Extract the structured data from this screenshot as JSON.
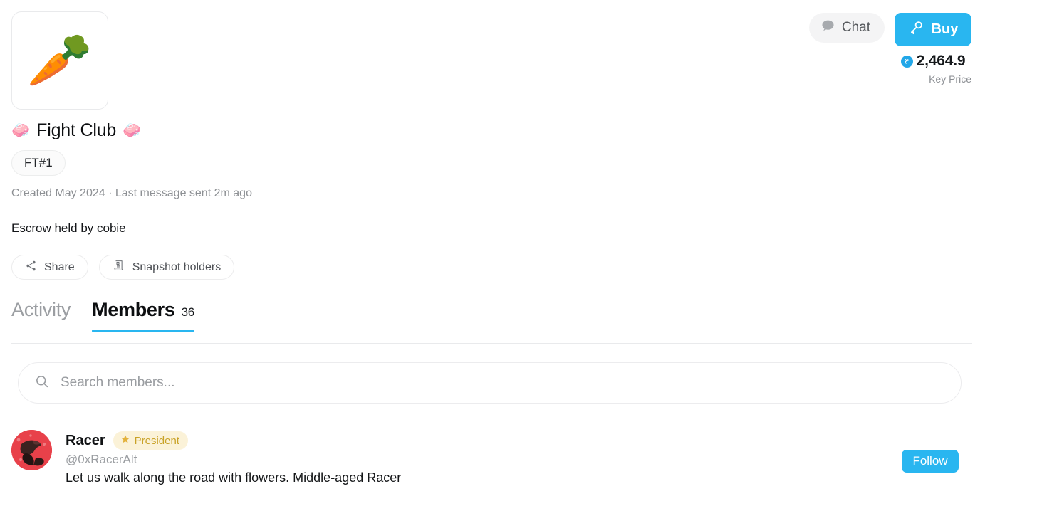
{
  "header": {
    "group_emoji": "🥕",
    "title_emoji_left": "🧼",
    "title_emoji_right": "🧼",
    "title": "Fight Club",
    "ticker_badge": "FT#1",
    "meta": "Created May 2024 · Last message sent 2m ago",
    "escrow": "Escrow held by cobie"
  },
  "actions": {
    "chat_label": "Chat",
    "chat_icon": "speech-bubble-icon",
    "buy_label": "Buy",
    "buy_icon": "key-icon",
    "price_value": "2,464.9",
    "price_coin_icon": "coin-icon",
    "price_label": "Key Price",
    "accent_color": "#29b6f0"
  },
  "chips": [
    {
      "label": "Share",
      "icon": "share-nodes-icon"
    },
    {
      "label": "Snapshot holders",
      "icon": "scroll-icon"
    }
  ],
  "tabs": [
    {
      "label": "Activity",
      "count": "",
      "active": false
    },
    {
      "label": "Members",
      "count": "36",
      "active": true
    }
  ],
  "search": {
    "placeholder": "Search members...",
    "value": "",
    "icon": "search-icon"
  },
  "members": [
    {
      "name": "Racer",
      "role": "President",
      "role_icon": "star-icon",
      "role_bg": "#fbf2d8",
      "role_color": "#c9a227",
      "handle": "@0xRacerAlt",
      "bio": "Let us walk along the road with flowers. Middle-aged Racer",
      "follow_label": "Follow",
      "avatar_bg": "#e8414a"
    }
  ]
}
